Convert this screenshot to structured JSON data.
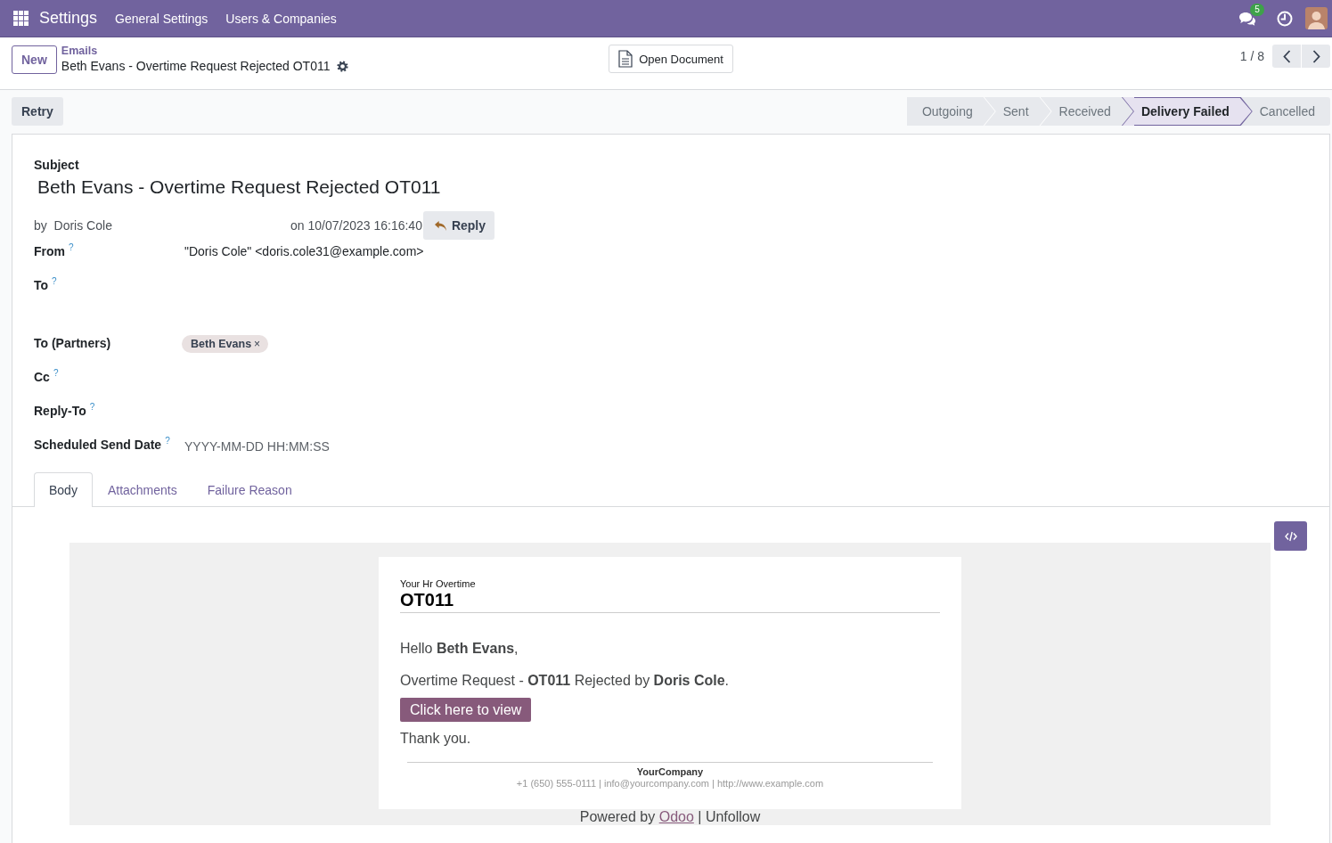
{
  "navbar": {
    "app": "Settings",
    "menu": [
      {
        "label": "General Settings"
      },
      {
        "label": "Users & Companies"
      }
    ],
    "notifications": "5"
  },
  "control_panel": {
    "new_button": "New",
    "breadcrumb": "Emails",
    "record_title": "Beth Evans - Overtime Request Rejected OT011",
    "open_document": "Open Document",
    "pager": "1 / 8"
  },
  "actions": {
    "retry": "Retry"
  },
  "status_bar": [
    {
      "label": "Outgoing",
      "selected": false
    },
    {
      "label": "Sent",
      "selected": false
    },
    {
      "label": "Received",
      "selected": false
    },
    {
      "label": "Delivery Failed",
      "selected": true
    },
    {
      "label": "Cancelled",
      "selected": false
    }
  ],
  "form": {
    "subject_label": "Subject",
    "subject": "Beth Evans - Overtime Request Rejected OT011",
    "author_prefix": "by",
    "author": "Doris Cole",
    "date": "on 10/07/2023 16:16:40",
    "reply_button": "Reply",
    "fields": [
      {
        "kind": "text",
        "label": "From",
        "help": "?",
        "value": "\"Doris Cole\" <doris.cole31@example.com>"
      },
      {
        "kind": "textarea",
        "label": "To",
        "help": "?"
      },
      {
        "kind": "tags",
        "label": "To (Partners)",
        "tags": [
          {
            "label": "Beth Evans",
            "remove": "×"
          }
        ]
      },
      {
        "kind": "text",
        "label": "Cc",
        "help": "?"
      },
      {
        "kind": "text",
        "label": "Reply-To",
        "help": "?"
      },
      {
        "kind": "datetime",
        "label": "Scheduled Send Date",
        "help": "?",
        "placeholder": "YYYY-MM-DD HH:MM:SS"
      }
    ]
  },
  "tabs": [
    {
      "label": "Body",
      "selected": true
    },
    {
      "label": "Attachments",
      "selected": false
    },
    {
      "label": "Failure Reason",
      "selected": false
    }
  ],
  "email": {
    "header_small": "Your Hr Overtime",
    "header_title": "OT011",
    "greeting": "Hello **Beth Evans**,",
    "message": "Overtime Request - **OT011** Rejected by **Doris Cole**.",
    "button": "Click here to view",
    "thanks": "Thank you.",
    "company": "YourCompany",
    "contact": "+1 (650) 555-0111 | info@yourcompany.com | http://www.example.com",
    "footer": {
      "before": "Powered by",
      "link": "Odoo",
      "after": "| Unfollow"
    }
  }
}
